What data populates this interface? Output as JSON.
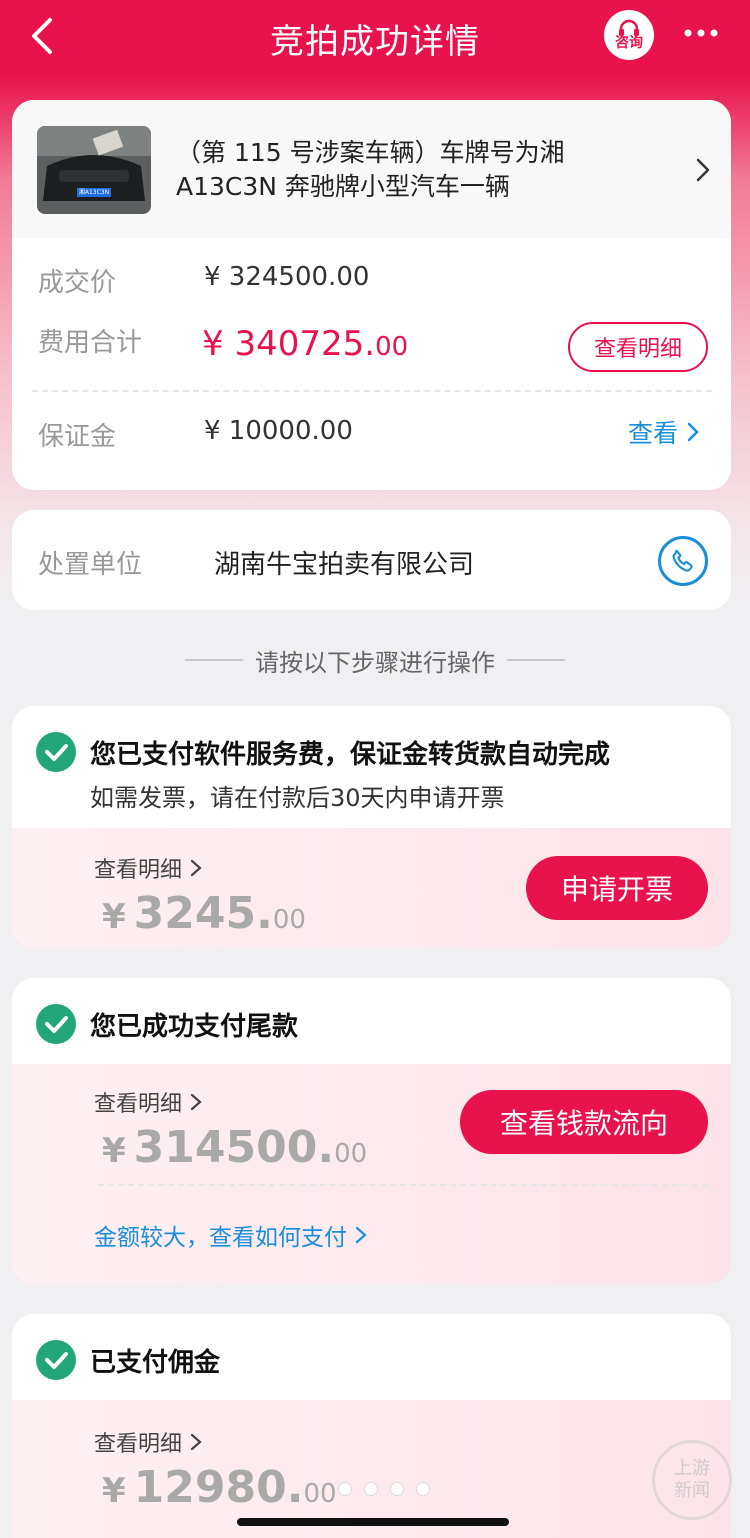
{
  "header": {
    "title": "竞拍成功详情",
    "consult_label": "咨询"
  },
  "product": {
    "title_line1": "（第 115 号涉案车辆）车牌号为湘",
    "title_line2": "A13C3N 奔驰牌小型汽车一辆",
    "plate": "湘A13C3N"
  },
  "price": {
    "deal_label": "成交价",
    "deal_value": "¥ 324500.00",
    "total_label": "费用合计",
    "total_yen": "¥ ",
    "total_int": "340725.",
    "total_dec": "00",
    "detail_btn": "查看明细",
    "deposit_label": "保证金",
    "deposit_value": "¥ 10000.00",
    "deposit_link": "查看"
  },
  "disposal": {
    "label": "处置单位",
    "value": "湖南牛宝拍卖有限公司"
  },
  "steps_header": "请按以下步骤进行操作",
  "steps": [
    {
      "title": "您已支付软件服务费，保证金转货款自动完成",
      "subtitle": "如需发票，请在付款后30天内申请开票",
      "detail_link": "查看明细",
      "yen": "¥",
      "amount_int": "3245.",
      "amount_dec": "00",
      "button": "申请开票"
    },
    {
      "title": "您已成功支付尾款",
      "detail_link": "查看明细",
      "yen": "¥",
      "amount_int": "314500.",
      "amount_dec": "00",
      "button": "查看钱款流向",
      "help_link": "金额较大，查看如何支付"
    },
    {
      "title": "已支付佣金",
      "detail_link": "查看明细",
      "yen": "¥",
      "amount_int": "12980.",
      "amount_dec": "00"
    }
  ],
  "watermark": {
    "line1": "上游",
    "line2": "新闻"
  },
  "colors": {
    "brand": "#e8134d",
    "check": "#22a67a",
    "link": "#1a8ed8"
  }
}
